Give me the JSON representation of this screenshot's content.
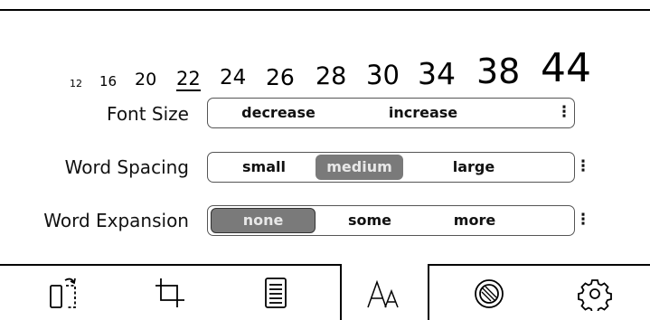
{
  "font_sizes": {
    "values": [
      "12",
      "16",
      "20",
      "22",
      "24",
      "26",
      "28",
      "30",
      "34",
      "38",
      "44"
    ],
    "selected": "22"
  },
  "font_size_row": {
    "label": "Font Size",
    "decrease_label": "decrease",
    "increase_label": "increase",
    "more_label": "⋮"
  },
  "word_spacing_row": {
    "label": "Word Spacing",
    "options": [
      "small",
      "medium",
      "large"
    ],
    "selected": "medium",
    "more_label": "⋮"
  },
  "word_expansion_row": {
    "label": "Word Expansion",
    "options": [
      "none",
      "some",
      "more"
    ],
    "selected": "none",
    "more_label": "⋮"
  },
  "bottom_tabs": {
    "items": [
      "rotate-page-icon",
      "crop-icon",
      "page-layout-icon",
      "font-icon",
      "contrast-icon",
      "settings-gear-icon"
    ],
    "active": "font-icon"
  }
}
